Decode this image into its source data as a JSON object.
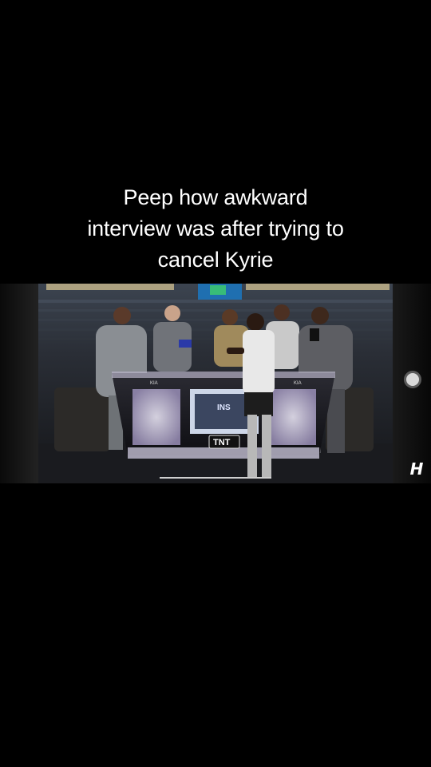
{
  "caption": {
    "line1": "Peep how awkward",
    "line2": "interview was after trying to",
    "line3": "cancel Kyrie"
  },
  "video": {
    "desk_logo": "TNT",
    "monitor_text": "INS",
    "sponsor": "KIA",
    "watermark": "H"
  },
  "colors": {
    "background": "#000000",
    "caption_text": "#ffffff"
  },
  "icons": {
    "scrub_handle": "circle-handle-icon",
    "watermark": "h-logo-icon"
  }
}
